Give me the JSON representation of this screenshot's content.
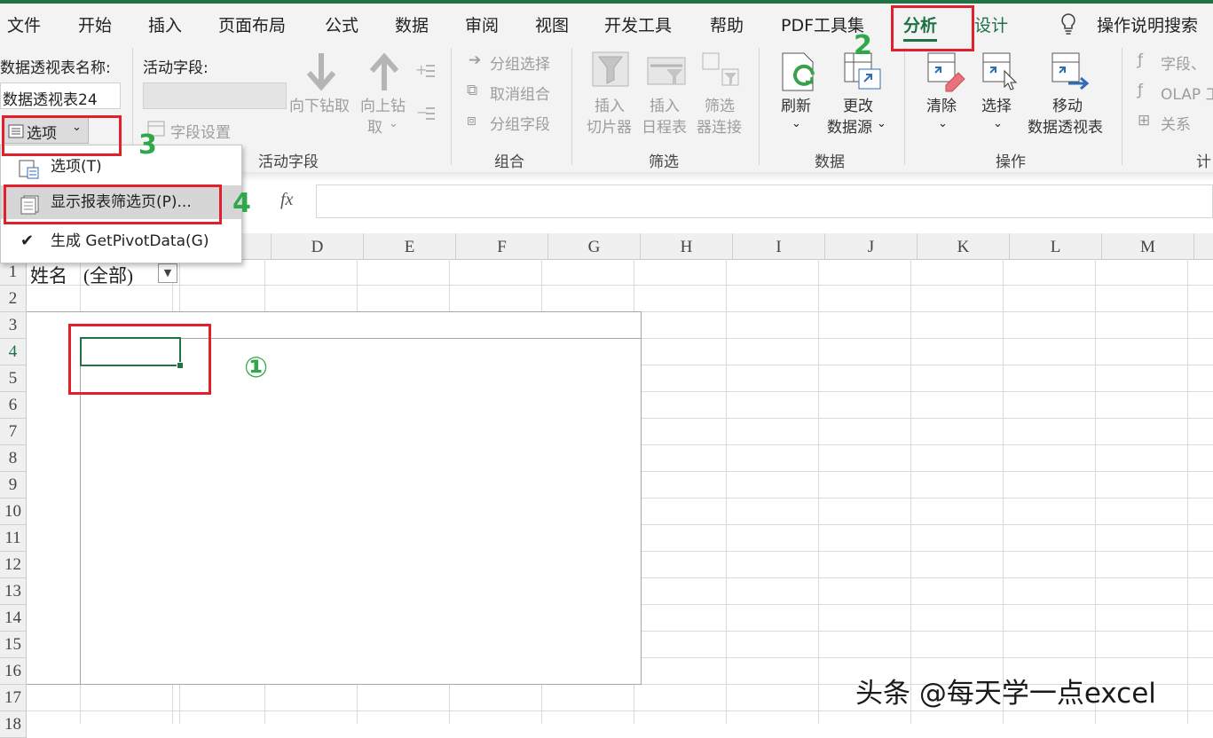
{
  "tabs": [
    "文件",
    "开始",
    "插入",
    "页面布局",
    "公式",
    "数据",
    "审阅",
    "视图",
    "开发工具",
    "帮助",
    "PDF工具集",
    "分析",
    "设计"
  ],
  "tell_me": "操作说明搜索",
  "pivot_name": {
    "label": "数据透视表名称:",
    "value": "数据透视表24",
    "options_button": "选项"
  },
  "active_field": {
    "label": "活动字段:",
    "field_settings": "字段设置",
    "drill_down": "向下钻取",
    "drill_up_1": "向上钻",
    "drill_up_2": "取",
    "group_label": "活动字段"
  },
  "group": {
    "group_selection": "分组选择",
    "ungroup": "取消组合",
    "group_field": "分组字段",
    "label": "组合"
  },
  "filter": {
    "slicer_1": "插入",
    "slicer_2": "切片器",
    "timeline_1": "插入",
    "timeline_2": "日程表",
    "conn_1": "筛选",
    "conn_2": "器连接",
    "label": "筛选"
  },
  "data": {
    "refresh": "刷新",
    "change_source_1": "更改",
    "change_source_2": "数据源",
    "label": "数据"
  },
  "actions": {
    "clear": "清除",
    "select": "选择",
    "move_1": "移动",
    "move_2": "数据透视表",
    "label": "操作"
  },
  "calc": {
    "fields": "字段、",
    "olap": "OLAP 工",
    "relations": "关系",
    "label": "计"
  },
  "menu": {
    "items": [
      "选项(T)",
      "显示报表筛选页(P)...",
      "生成 GetPivotData(G)"
    ]
  },
  "formula": {
    "fx": "fx"
  },
  "columns": [
    "D",
    "E",
    "F",
    "G",
    "H",
    "I",
    "J",
    "K",
    "L",
    "M"
  ],
  "rows": [
    "1",
    "2",
    "3",
    "4",
    "5",
    "6",
    "7",
    "8",
    "9",
    "10",
    "11",
    "12",
    "13",
    "14",
    "15",
    "16",
    "17",
    "18"
  ],
  "cells": {
    "a1": "姓名",
    "b1": "(全部)"
  },
  "annotations": {
    "n1": "①",
    "n2": "2",
    "n3": "3",
    "n4": "4"
  },
  "watermark": "头条 @每天学一点excel"
}
